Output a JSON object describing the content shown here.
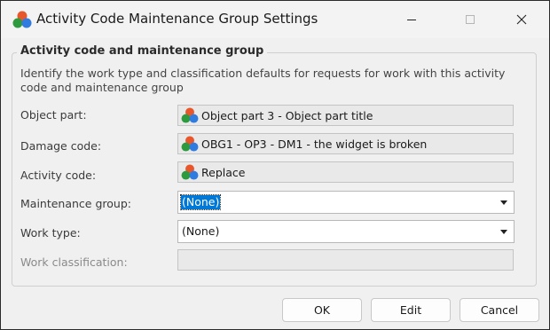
{
  "window": {
    "title": "Activity Code Maintenance Group Settings",
    "icon": "colored-balls-icon"
  },
  "group": {
    "title": "Activity code and maintenance group",
    "description": "Identify the work type and classification defaults for requests for work with this activity code and maintenance group"
  },
  "fields": {
    "object_part": {
      "label": "Object part:",
      "value": "Object part 3 - Object part title",
      "icon": "colored-balls-icon"
    },
    "damage_code": {
      "label": "Damage code:",
      "value": "OBG1 - OP3 - DM1 - the widget is broken",
      "icon": "colored-balls-icon"
    },
    "activity_code": {
      "label": "Activity code:",
      "value": "Replace",
      "icon": "colored-balls-icon"
    },
    "maintenance_group": {
      "label": "Maintenance group:",
      "value": "(None)",
      "selected": true
    },
    "work_type": {
      "label": "Work type:",
      "value": "(None)"
    },
    "work_classification": {
      "label": "Work classification:",
      "value": "",
      "disabled": true
    }
  },
  "buttons": {
    "ok": "OK",
    "edit": "Edit",
    "cancel": "Cancel"
  },
  "colors": {
    "selection": "#0078d7",
    "window_bg": "#f0f0f0",
    "readonly_field_bg": "#e9e9e9"
  }
}
